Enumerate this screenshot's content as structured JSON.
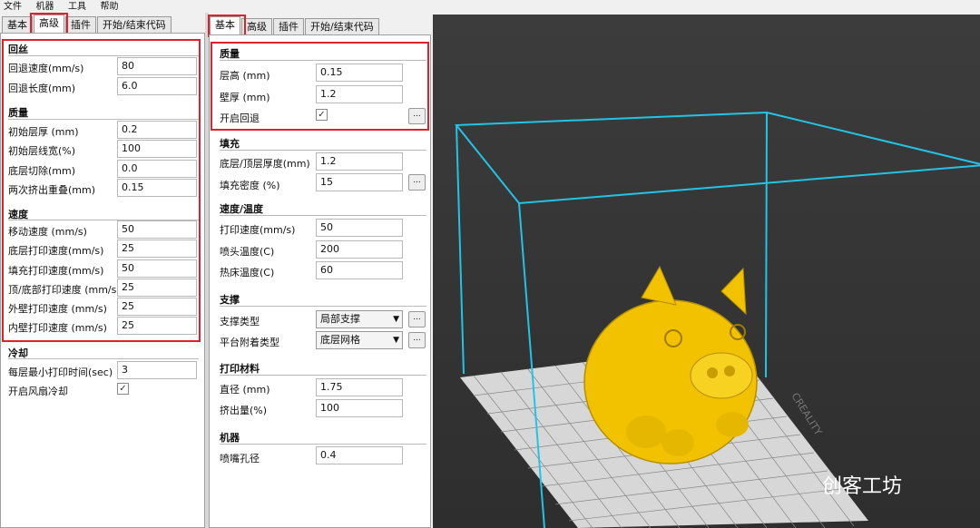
{
  "menu": [
    "文件",
    "机器",
    "工具",
    "帮助"
  ],
  "left_tabs": [
    "基本",
    "高级",
    "插件",
    "开始/结束代码"
  ],
  "mid_tabs": [
    "基本",
    "高级",
    "插件",
    "开始/结束代码"
  ],
  "left": {
    "retraction": {
      "title": "回丝",
      "rows": [
        {
          "label": "回退速度(mm/s)",
          "value": "80"
        },
        {
          "label": "回退长度(mm)",
          "value": "6.0"
        }
      ]
    },
    "quality": {
      "title": "质量",
      "rows": [
        {
          "label": "初始层厚 (mm)",
          "value": "0.2"
        },
        {
          "label": "初始层线宽(%)",
          "value": "100"
        },
        {
          "label": "底层切除(mm)",
          "value": "0.0"
        },
        {
          "label": "两次挤出重叠(mm)",
          "value": "0.15"
        }
      ]
    },
    "speed": {
      "title": "速度",
      "rows": [
        {
          "label": "移动速度 (mm/s)",
          "value": "50"
        },
        {
          "label": "底层打印速度(mm/s)",
          "value": "25"
        },
        {
          "label": "填充打印速度(mm/s)",
          "value": "50"
        },
        {
          "label": "顶/底部打印速度 (mm/s)",
          "value": "25"
        },
        {
          "label": "外壁打印速度 (mm/s)",
          "value": "25"
        },
        {
          "label": "内壁打印速度 (mm/s)",
          "value": "25"
        }
      ]
    },
    "cool": {
      "title": "冷却",
      "rows": [
        {
          "label": "每层最小打印时间(sec)",
          "value": "3"
        },
        {
          "label": "开启风扇冷却",
          "value": "✓"
        }
      ]
    }
  },
  "mid": {
    "quality": {
      "title": "质量",
      "rows": [
        {
          "label": "层高 (mm)",
          "value": "0.15"
        },
        {
          "label": "壁厚 (mm)",
          "value": "1.2"
        },
        {
          "label": "开启回退",
          "value": "✓"
        }
      ]
    },
    "fill": {
      "title": "填充",
      "rows": [
        {
          "label": "底层/顶层厚度(mm)",
          "value": "1.2"
        },
        {
          "label": "填充密度 (%)",
          "value": "15"
        }
      ]
    },
    "speed": {
      "title": "速度/温度",
      "rows": [
        {
          "label": "打印速度(mm/s)",
          "value": "50"
        },
        {
          "label": "喷头温度(C)",
          "value": "200"
        },
        {
          "label": "热床温度(C)",
          "value": "60"
        }
      ]
    },
    "support": {
      "title": "支撑",
      "rows": [
        {
          "label": "支撑类型",
          "value": "局部支撑"
        },
        {
          "label": "平台附着类型",
          "value": "底层网格"
        }
      ]
    },
    "material": {
      "title": "打印材料",
      "rows": [
        {
          "label": "直径 (mm)",
          "value": "1.75"
        },
        {
          "label": "挤出量(%)",
          "value": "100"
        }
      ]
    },
    "machine": {
      "title": "机器",
      "rows": [
        {
          "label": "喷嘴孔径",
          "value": "0.4"
        }
      ]
    }
  },
  "dots_label": "...",
  "arrow": "▼",
  "watermark": "创客工坊",
  "bed_label": "CREALITY",
  "colors": {
    "highlight": "#e0202a",
    "box": "#22c4e6",
    "model": "#f2c200"
  }
}
